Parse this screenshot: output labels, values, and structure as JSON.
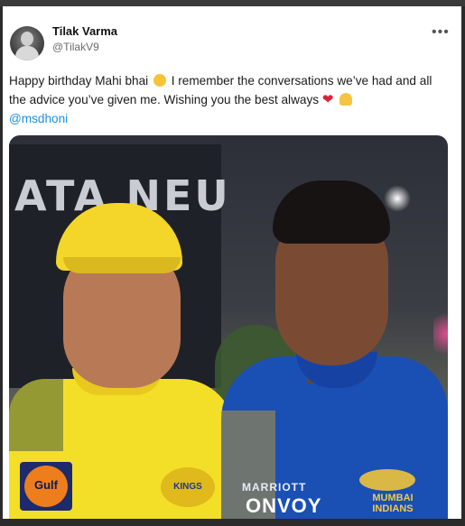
{
  "post": {
    "author_name": "Tilak Varma",
    "author_handle": "@TilakV9",
    "more_label": "•••",
    "text_part1": "Happy birthday Mahi bhai",
    "text_part2": " I remember the conversations we’ve had and all the advice you’ve given me. Wishing you the best always ",
    "mention": "@msdhoni",
    "heart_glyph": "❤"
  },
  "image": {
    "background_sign": "ATA NEU",
    "left_sponsor": "Gulf",
    "left_crest": "KINGS",
    "right_sponsor_top": "MARRIOTT",
    "right_sponsor_bottom": "ONVOY",
    "right_team_line1": "MUMBAI",
    "right_team_line2": "INDIANS"
  },
  "colors": {
    "mention": "#1d8fe3",
    "csk_yellow": "#f3df27",
    "mi_blue": "#1a4fb4"
  },
  "icons": [
    "avatar",
    "more-options-icon",
    "hugging-face-emoji",
    "red-heart-emoji",
    "folded-hands-emoji"
  ]
}
